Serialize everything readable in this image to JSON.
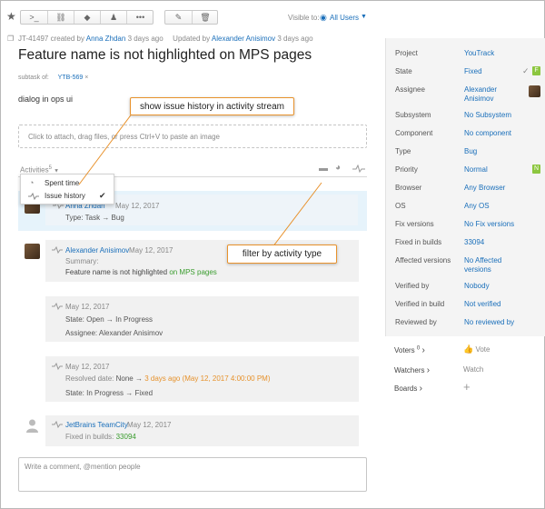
{
  "toolbar": {
    "visible_to_label": "Visible to:",
    "visibility_value": "All Users",
    "segment_icons": [
      "terminal-icon",
      "link-icon",
      "tag-icon",
      "user-icon",
      "more-icon"
    ],
    "edit_icon": "pencil-icon",
    "delete_icon": "trash-icon",
    "star_icon": "star-icon"
  },
  "issue": {
    "id": "JT-41497",
    "created_by_prefix": "created by",
    "created_by": "Anna Zhdan",
    "created_when": "3 days ago",
    "updated_by_prefix": "Updated by",
    "updated_by": "Alexander Anisimov",
    "updated_when": "3 days ago",
    "title": "Feature name is not highlighted on MPS pages",
    "subtask_of_label": "subtask of:",
    "subtask_of": "YTB-569",
    "subtask_remove": "×",
    "description": "dialog in ops ui",
    "attach_placeholder": "Click to attach, drag files, or press Ctrl+V to paste an image"
  },
  "activities": {
    "label": "Activities",
    "count_superscript": "5",
    "menu": [
      {
        "label": "Spent time",
        "checked": false,
        "icon": "clock-icon"
      },
      {
        "label": "Issue history",
        "checked": true,
        "icon": "pulse-icon"
      }
    ],
    "checkmark": "✔",
    "items": [
      {
        "author": "Anna Zhdan",
        "date": "May 12, 2017",
        "lines": [
          "Type: Task → Bug"
        ]
      },
      {
        "author": "Alexander Anisimov",
        "date": "May 12, 2017",
        "summary_label": "Summary:",
        "summary_text": "Feature name is not highlighted",
        "summary_added": "on MPS pages"
      },
      {
        "date": "May 12, 2017",
        "lines": [
          "State: Open → In Progress",
          "Assignee: Alexander Anisimov"
        ]
      },
      {
        "date": "May 12, 2017",
        "resolved_label": "Resolved date:",
        "resolved_old": "None →",
        "resolved_new": "3 days ago (May 12, 2017 4:00:00 PM)",
        "state_line": "State: In Progress → Fixed"
      },
      {
        "author": "JetBrains TeamCity",
        "date": "May 12, 2017",
        "fixed_label": "Fixed in builds:",
        "fixed_value": "33094"
      }
    ],
    "comment_placeholder": "Write a comment, @mention people"
  },
  "callouts": {
    "history": "show issue history in activity stream",
    "filter": "filter by activity type"
  },
  "fields": [
    {
      "label": "Project",
      "value": "YouTrack"
    },
    {
      "label": "State",
      "value": "Fixed",
      "badge": "F"
    },
    {
      "label": "Assignee",
      "value": "Alexander Anisimov"
    },
    {
      "label": "Subsystem",
      "value": "No Subsystem"
    },
    {
      "label": "Component",
      "value": "No component"
    },
    {
      "label": "Type",
      "value": "Bug"
    },
    {
      "label": "Priority",
      "value": "Normal",
      "badge": "N"
    },
    {
      "label": "Browser",
      "value": "Any Browser"
    },
    {
      "label": "OS",
      "value": "Any OS"
    },
    {
      "label": "Fix versions",
      "value": "No Fix versions"
    },
    {
      "label": "Fixed in builds",
      "value": "33094"
    },
    {
      "label": "Affected versions",
      "value": "No Affected versions"
    },
    {
      "label": "Verified by",
      "value": "Nobody"
    },
    {
      "label": "Verified in build",
      "value": "Not verified"
    },
    {
      "label": "Reviewed by",
      "value": "No reviewed by"
    }
  ],
  "sidebar_extra": {
    "voters_label": "Voters",
    "voters_count": "0",
    "vote_label": "Vote",
    "watchers_label": "Watchers",
    "watch_label": "Watch",
    "boards_label": "Boards",
    "add_symbol": "+",
    "chevron": "›"
  },
  "colors": {
    "accent": "#1a6fba",
    "callout_border": "#e8922c",
    "added_text": "#3a9c2e",
    "highlight_bg": "#e6f3fb",
    "state_badge": "#8cc63f"
  }
}
